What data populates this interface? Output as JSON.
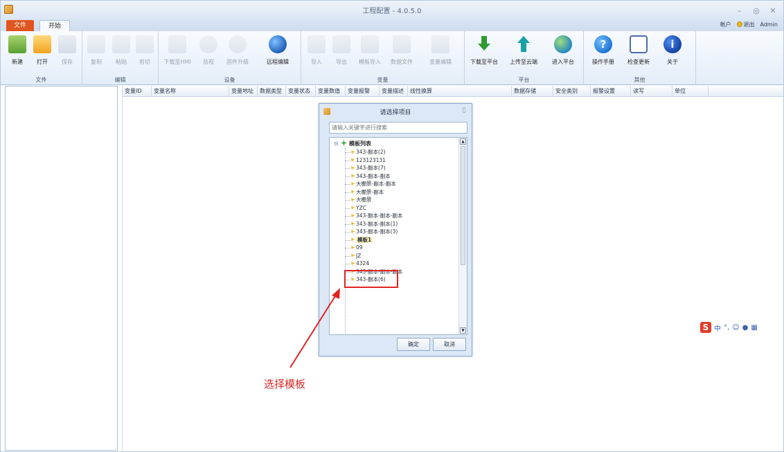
{
  "window": {
    "title": "工程配置 - 4.0.5.0"
  },
  "tabs": {
    "file": "文件",
    "start": "开始"
  },
  "account": {
    "username": "帐户",
    "logout": "退出",
    "user": "Admin"
  },
  "ribbon": {
    "groups": [
      "文件",
      "编辑",
      "设备",
      "变量",
      "平台",
      "其他"
    ],
    "file": {
      "new": "新建",
      "open": "打开",
      "save": "保存"
    },
    "edit": {
      "copy": "复制",
      "paste": "粘贴",
      "cut": "剪切"
    },
    "device": {
      "download": "下载至HMI",
      "monitor": "监视",
      "remote_upgrade": "固件升级",
      "remote_edit": "远程编辑"
    },
    "variable": {
      "import": "导入",
      "export": "导出",
      "template_import": "模板导入",
      "data_file": "数据文件",
      "batch_edit": "变量编辑"
    },
    "platform": {
      "download_platform": "下载至平台",
      "upload_cloud": "上传至云端",
      "enter_platform": "进入平台"
    },
    "other": {
      "manual": "操作手册",
      "check_update": "检查更新",
      "about": "关于"
    }
  },
  "table": {
    "columns": [
      "变量ID",
      "变量名称",
      "变量地址",
      "数据类型",
      "变量状态",
      "变量数值",
      "变量报警",
      "变量描述",
      "线性换算",
      "数据存储",
      "安全类别",
      "报警设置",
      "读写",
      "单位"
    ]
  },
  "dialog": {
    "title": "请选择项目",
    "search_placeholder": "请输入关键字进行搜索",
    "root": "模板列表",
    "items": [
      "343-副本(2)",
      "123123131",
      "343-副本(7)",
      "343-副本-副本",
      "大棚景-副本-副本",
      "大棚景-副本",
      "大棚景",
      "YZC",
      "343-副本-副本-副本",
      "343-副本-副本(1)",
      "343-副本-副本(3)",
      "模板1",
      "09",
      "JZ",
      "4324",
      "343-副本-副本-副本",
      "343-副本(6)"
    ],
    "selected": "模板1",
    "ok": "确定",
    "cancel": "取消"
  },
  "annotation": {
    "text": "选择模板",
    "color": "#e02424"
  },
  "ime": {
    "label": "中"
  },
  "colors": {
    "file_tab": "#e0541e",
    "accent": "#1f5fb8"
  }
}
